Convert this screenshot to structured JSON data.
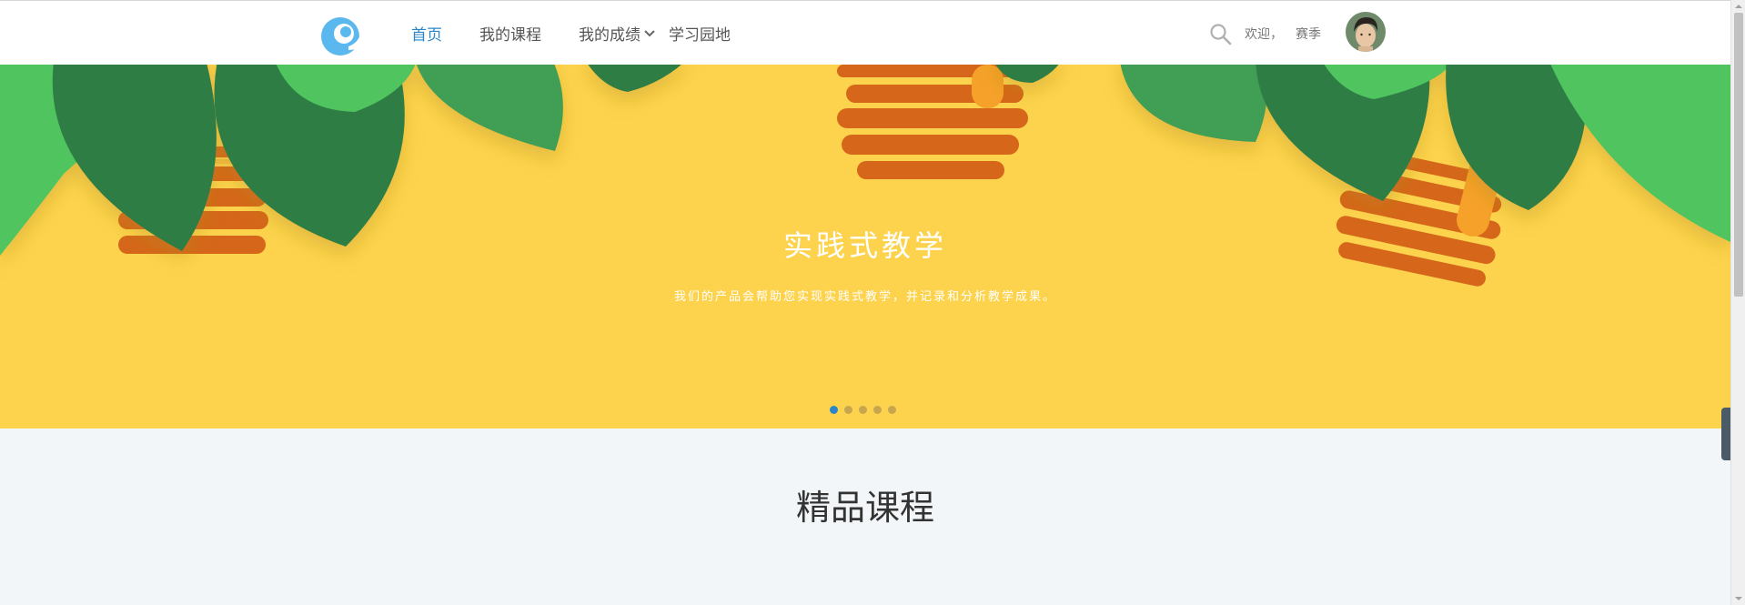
{
  "header": {
    "logo_icon": "logo-icon",
    "nav": [
      {
        "label": "首页",
        "active": true
      },
      {
        "label": "我的课程",
        "active": false
      },
      {
        "label": "我的成绩",
        "active": false,
        "dropdown": true
      },
      {
        "label": "学习园地",
        "active": false
      }
    ],
    "welcome_text": "欢迎，",
    "username": "赛季",
    "search_icon": "search-icon",
    "avatar_icon": "avatar"
  },
  "banner": {
    "title": "实践式教学",
    "subtitle": "我们的产品会帮助您实现实践式教学，并记录和分析教学成果。",
    "slides": 5,
    "active_slide": 1,
    "colors": {
      "background": "#fdd34d",
      "leaf_dark": "#2e7d44",
      "leaf_light": "#4fc45f",
      "stripe": "#d5661a"
    }
  },
  "section": {
    "title": "精品课程"
  },
  "accent_color": "#2a86c8"
}
